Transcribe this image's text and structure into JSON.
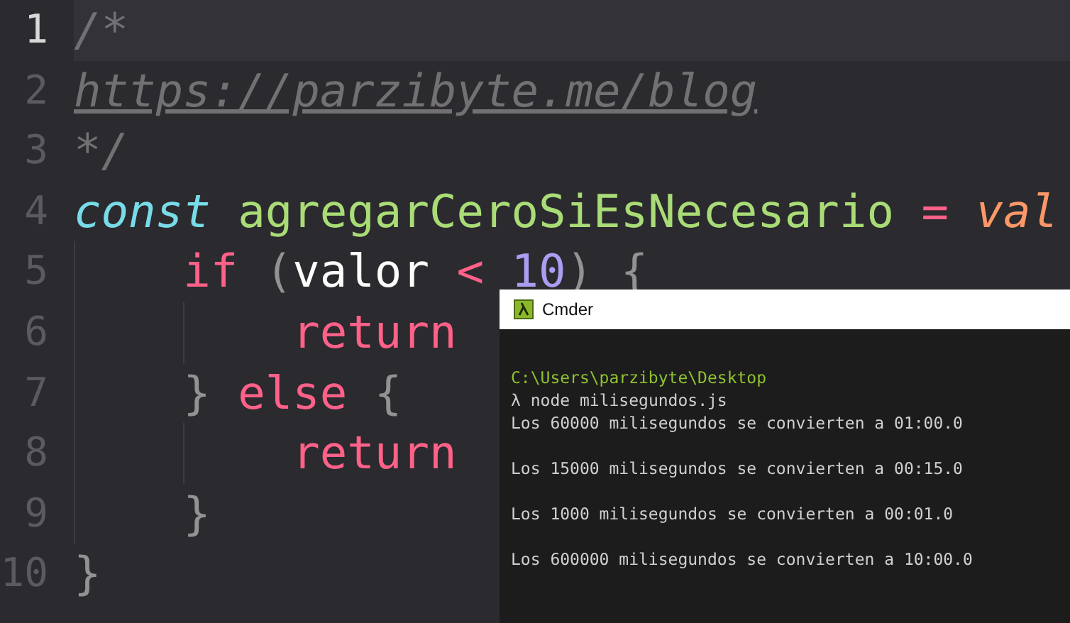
{
  "editor": {
    "lines": [
      {
        "number": "1",
        "current": true,
        "tokens": [
          {
            "kind": "comment",
            "text": "/*"
          }
        ]
      },
      {
        "number": "2",
        "current": false,
        "tokens": [
          {
            "kind": "link",
            "text": "https://parzibyte.me/blog"
          }
        ]
      },
      {
        "number": "3",
        "current": false,
        "tokens": [
          {
            "kind": "comment",
            "text": "*/"
          }
        ]
      },
      {
        "number": "4",
        "current": false,
        "tokens": [
          {
            "kind": "storage",
            "text": "const"
          },
          {
            "kind": "function",
            "text": "agregarCeroSiEsNecesario"
          },
          {
            "kind": "keyword",
            "text": "="
          },
          {
            "kind": "param",
            "text": "val"
          }
        ]
      },
      {
        "number": "5",
        "current": false,
        "tokens": [
          {
            "kind": "keyword",
            "text": "    if"
          },
          {
            "kind": "punct",
            "text": "("
          },
          {
            "kind": "variable",
            "text": "valor"
          },
          {
            "kind": "keyword",
            "text": "<"
          },
          {
            "kind": "number",
            "text": "10"
          },
          {
            "kind": "punct",
            "text": ")"
          },
          {
            "kind": "punct",
            "text": "{"
          }
        ]
      },
      {
        "number": "6",
        "current": false,
        "tokens": [
          {
            "kind": "keyword",
            "text": "        return"
          }
        ]
      },
      {
        "number": "7",
        "current": false,
        "tokens": [
          {
            "kind": "punct",
            "text": "    }"
          },
          {
            "kind": "keyword",
            "text": "else"
          },
          {
            "kind": "punct",
            "text": "{"
          }
        ]
      },
      {
        "number": "8",
        "current": false,
        "tokens": [
          {
            "kind": "keyword",
            "text": "        return"
          }
        ]
      },
      {
        "number": "9",
        "current": false,
        "tokens": [
          {
            "kind": "punct",
            "text": "    }"
          }
        ]
      },
      {
        "number": "10",
        "current": false,
        "tokens": [
          {
            "kind": "punct",
            "text": "}"
          }
        ]
      }
    ]
  },
  "terminal": {
    "title": "Cmder",
    "lines": [
      {
        "kind": "path",
        "text": "C:\\Users\\parzibyte\\Desktop"
      },
      {
        "kind": "command",
        "prompt": "λ",
        "text": "node milisegundos.js"
      },
      {
        "kind": "output",
        "text": "Los 60000 milisegundos se convierten a 01:00.0"
      },
      {
        "kind": "output",
        "text": "Los 15000 milisegundos se convierten a 00:15.0"
      },
      {
        "kind": "output",
        "text": "Los 1000 milisegundos se convierten a 00:01.0"
      },
      {
        "kind": "output",
        "text": "Los 600000 milisegundos se convierten a 10:00.0"
      }
    ]
  }
}
